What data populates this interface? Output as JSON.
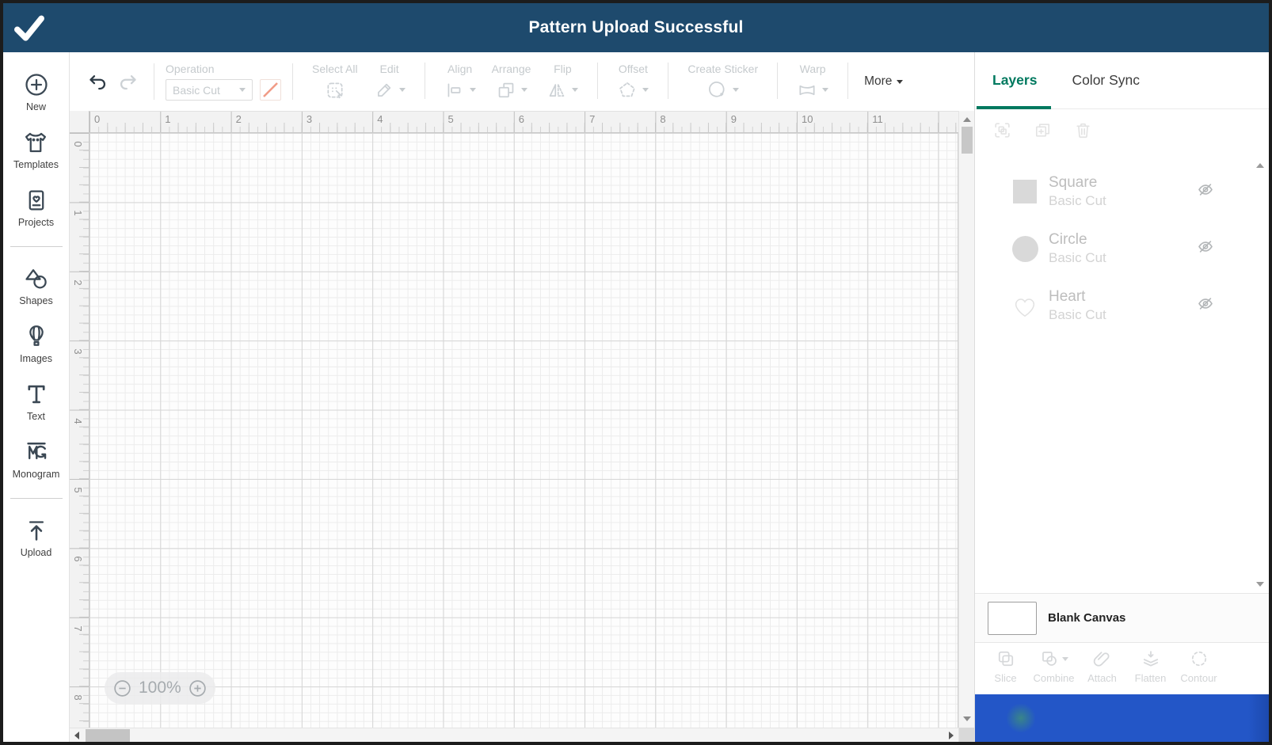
{
  "banner": {
    "title": "Pattern Upload Successful",
    "check_icon": "checkmark-icon",
    "background": "#1e4a6d"
  },
  "sidebar": {
    "items": [
      {
        "id": "new",
        "label": "New",
        "icon": "plus-circle-icon",
        "divider_after": false
      },
      {
        "id": "templates",
        "label": "Templates",
        "icon": "tshirt-icon",
        "divider_after": false
      },
      {
        "id": "projects",
        "label": "Projects",
        "icon": "project-card-icon",
        "divider_after": true
      },
      {
        "id": "shapes",
        "label": "Shapes",
        "icon": "shapes-icon",
        "divider_after": false
      },
      {
        "id": "images",
        "label": "Images",
        "icon": "balloon-icon",
        "divider_after": false
      },
      {
        "id": "text",
        "label": "Text",
        "icon": "text-icon",
        "divider_after": false
      },
      {
        "id": "monogram",
        "label": "Monogram",
        "icon": "monogram-icon",
        "divider_after": true
      },
      {
        "id": "upload",
        "label": "Upload",
        "icon": "upload-icon",
        "divider_after": false
      }
    ]
  },
  "toolbar": {
    "undo_icon": "undo-icon",
    "redo_icon": "redo-icon",
    "operation": {
      "label": "Operation",
      "value": "Basic Cut",
      "swatch_color": "#f19c87"
    },
    "groups": [
      {
        "items": [
          {
            "id": "select-all",
            "label": "Select All",
            "icon": "select-all-icon",
            "caret": false
          },
          {
            "id": "edit",
            "label": "Edit",
            "icon": "pencil-icon",
            "caret": true
          }
        ]
      },
      {
        "items": [
          {
            "id": "align",
            "label": "Align",
            "icon": "align-icon",
            "caret": true
          },
          {
            "id": "arrange",
            "label": "Arrange",
            "icon": "arrange-icon",
            "caret": true
          },
          {
            "id": "flip",
            "label": "Flip",
            "icon": "flip-icon",
            "caret": true
          }
        ]
      },
      {
        "items": [
          {
            "id": "offset",
            "label": "Offset",
            "icon": "offset-icon",
            "caret": true
          }
        ]
      },
      {
        "items": [
          {
            "id": "create-sticker",
            "label": "Create Sticker",
            "icon": "sticker-icon",
            "caret": true
          }
        ]
      },
      {
        "items": [
          {
            "id": "warp",
            "label": "Warp",
            "icon": "warp-icon",
            "caret": true
          }
        ]
      }
    ],
    "more_label": "More"
  },
  "canvas": {
    "zoom_level": "100%",
    "h_ruler": [
      "0",
      "1",
      "2",
      "3",
      "4",
      "5",
      "6",
      "7",
      "8",
      "9",
      "10",
      "11"
    ],
    "v_ruler": [
      "0",
      "1",
      "2",
      "3",
      "4",
      "5",
      "6",
      "7",
      "8"
    ]
  },
  "panel": {
    "tabs": [
      {
        "id": "layers",
        "label": "Layers",
        "active": true
      },
      {
        "id": "color-sync",
        "label": "Color Sync",
        "active": false
      }
    ],
    "layer_ops": [
      {
        "id": "group",
        "icon": "group-icon"
      },
      {
        "id": "duplicate",
        "icon": "duplicate-icon"
      },
      {
        "id": "delete",
        "icon": "trash-icon"
      }
    ],
    "layers": [
      {
        "name": "Square",
        "operation": "Basic Cut",
        "shape": "square",
        "hidden": true
      },
      {
        "name": "Circle",
        "operation": "Basic Cut",
        "shape": "circle",
        "hidden": true
      },
      {
        "name": "Heart",
        "operation": "Basic Cut",
        "shape": "heart",
        "hidden": true
      }
    ],
    "canvas_row": {
      "label": "Blank Canvas"
    },
    "actions": [
      {
        "id": "slice",
        "label": "Slice",
        "icon": "slice-icon",
        "caret": false
      },
      {
        "id": "combine",
        "label": "Combine",
        "icon": "combine-icon",
        "caret": true
      },
      {
        "id": "attach",
        "label": "Attach",
        "icon": "attach-icon",
        "caret": false
      },
      {
        "id": "flatten",
        "label": "Flatten",
        "icon": "flatten-icon",
        "caret": false
      },
      {
        "id": "contour",
        "label": "Contour",
        "icon": "contour-icon",
        "caret": false
      }
    ],
    "primary_button_color": "#2356c7"
  },
  "colors": {
    "banner_blue": "#1e4a6d",
    "accent_green": "#00795f",
    "action_blue": "#2356c7",
    "swatch_salmon": "#f19c87"
  }
}
